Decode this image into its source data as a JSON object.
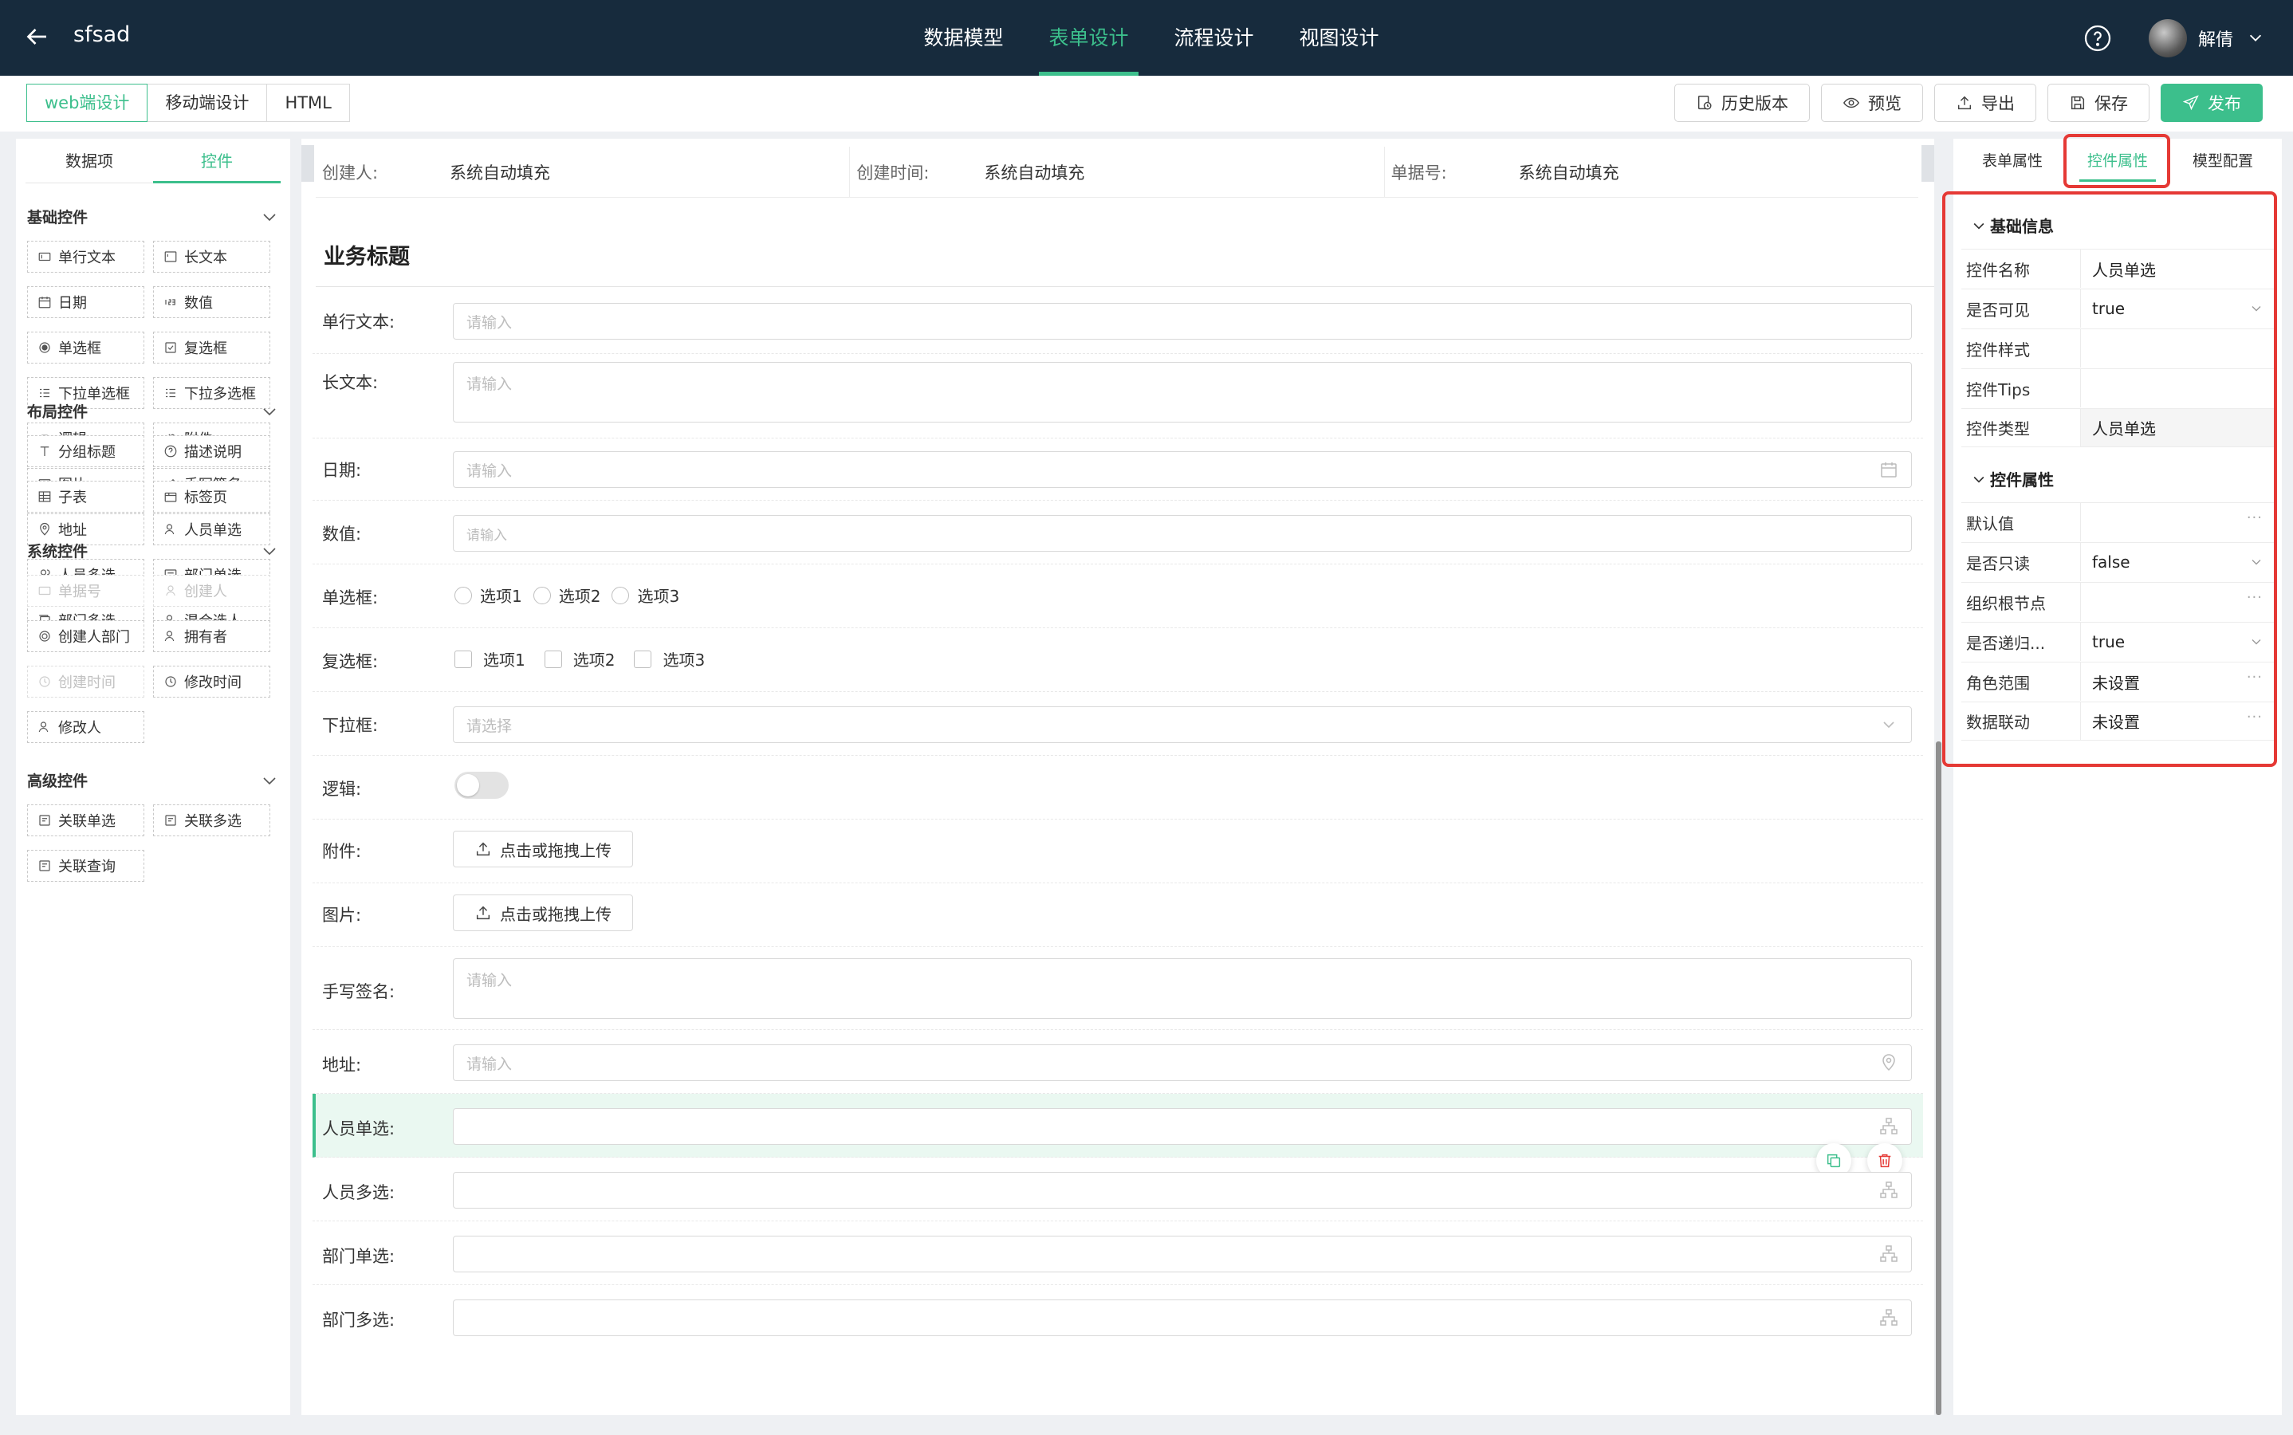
{
  "header": {
    "app_title": "sfsad",
    "nav_tabs": [
      "数据模型",
      "表单设计",
      "流程设计",
      "视图设计"
    ],
    "active_nav": "表单设计",
    "user_name": "解倩"
  },
  "mode_tabs": [
    "web端设计",
    "移动端设计",
    "HTML"
  ],
  "toolbar": {
    "history": "历史版本",
    "preview": "预览",
    "export": "导出",
    "save": "保存",
    "publish": "发布"
  },
  "left_panel": {
    "tabs": [
      "数据项",
      "控件"
    ],
    "groups": [
      {
        "title": "基础控件",
        "items": [
          "单行文本",
          "长文本",
          "日期",
          "数值",
          "单选框",
          "复选框",
          "下拉单选框",
          "下拉多选框",
          "逻辑",
          "附件",
          "图片",
          "手写签名",
          "地址",
          "人员单选",
          "人员多选",
          "部门单选",
          "部门多选",
          "混合选人"
        ]
      },
      {
        "title": "布局控件",
        "items": [
          "分组标题",
          "描述说明",
          "子表",
          "标签页"
        ]
      },
      {
        "title": "系统控件",
        "items": [
          "单据号",
          "创建人",
          "创建人部门",
          "拥有者",
          "创建时间",
          "修改时间",
          "修改人"
        ]
      },
      {
        "title": "高级控件",
        "items": [
          "关联单选",
          "关联多选",
          "关联查询"
        ]
      }
    ]
  },
  "form": {
    "system_fields": [
      {
        "label": "创建人:",
        "value": "系统自动填充"
      },
      {
        "label": "创建时间:",
        "value": "系统自动填充"
      },
      {
        "label": "单据号:",
        "value": "系统自动填充"
      }
    ],
    "business_title": "业务标题",
    "fields": {
      "single_text": {
        "label": "单行文本:",
        "placeholder": "请输入"
      },
      "long_text": {
        "label": "长文本:",
        "placeholder": "请输入"
      },
      "date": {
        "label": "日期:",
        "placeholder": "请输入"
      },
      "number": {
        "label": "数值:",
        "placeholder": "请输入"
      },
      "radio": {
        "label": "单选框:",
        "options": [
          "选项1",
          "选项2",
          "选项3"
        ]
      },
      "checkbox": {
        "label": "复选框:",
        "options": [
          "选项1",
          "选项2",
          "选项3"
        ]
      },
      "dropdown": {
        "label": "下拉框:",
        "placeholder": "请选择"
      },
      "logic": {
        "label": "逻辑:"
      },
      "attachment": {
        "label": "附件:",
        "button": "点击或拖拽上传"
      },
      "image": {
        "label": "图片:",
        "button": "点击或拖拽上传"
      },
      "signature": {
        "label": "手写签名:",
        "placeholder": "请输入"
      },
      "address": {
        "label": "地址:",
        "placeholder": "请输入"
      },
      "person_single": {
        "label": "人员单选:"
      },
      "person_multi": {
        "label": "人员多选:"
      },
      "dept_single": {
        "label": "部门单选:"
      },
      "dept_multi": {
        "label": "部门多选:"
      }
    }
  },
  "right_panel": {
    "tabs": [
      "表单属性",
      "控件属性",
      "模型配置"
    ],
    "sections": [
      {
        "title": "基础信息",
        "rows": [
          {
            "key": "控件名称",
            "value": "人员单选"
          },
          {
            "key": "是否可见",
            "value": "true"
          },
          {
            "key": "控件样式",
            "value": ""
          },
          {
            "key": "控件Tips",
            "value": ""
          },
          {
            "key": "控件类型",
            "value": "人员单选"
          }
        ]
      },
      {
        "title": "控件属性",
        "rows": [
          {
            "key": "默认值",
            "value": ""
          },
          {
            "key": "是否只读",
            "value": "false"
          },
          {
            "key": "组织根节点",
            "value": ""
          },
          {
            "key": "是否递归...",
            "value": "true"
          },
          {
            "key": "角色范围",
            "value": "未设置"
          },
          {
            "key": "数据联动",
            "value": "未设置"
          }
        ]
      }
    ]
  },
  "colors": {
    "accent": "#3cbf8c",
    "header_bg": "#172b3d",
    "highlight": "#e53935"
  }
}
